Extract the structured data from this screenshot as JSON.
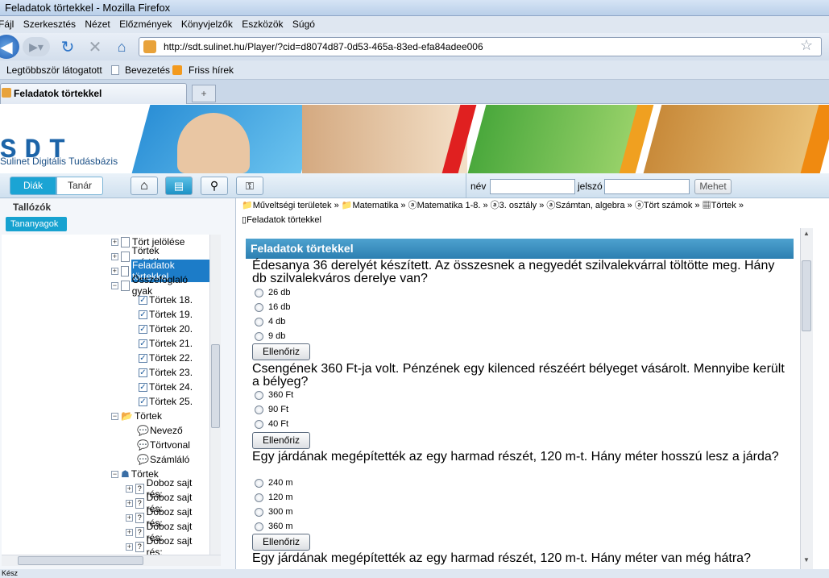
{
  "window": {
    "title": "Feladatok törtekkel - Mozilla Firefox"
  },
  "menu": [
    "Fájl",
    "Szerkesztés",
    "Nézet",
    "Előzmények",
    "Könyvjelzők",
    "Eszközök",
    "Súgó"
  ],
  "address": {
    "url": "http://sdt.sulinet.hu/Player/?cid=d8074d87-0d53-465a-83ed-efa84adee006"
  },
  "bookmarks": [
    "Legtöbbször látogatott",
    "Bevezetés",
    "Friss hírek"
  ],
  "tab": {
    "label": "Feladatok törtekkel"
  },
  "site": {
    "logo": "SDT",
    "logo_sub": "Sulinet Digitális Tudásbázis"
  },
  "modes": {
    "student": "Diák",
    "teacher": "Tanár"
  },
  "login": {
    "name_label": "név",
    "password_label": "jelszó",
    "submit": "Mehet"
  },
  "sidebar": {
    "title": "Tallózók",
    "tab": "Tananyagok",
    "items": [
      "Tört jelölése",
      "Törtek mértékegys",
      "Feladatok törtekkel",
      "Összefoglaló gyak",
      "Törtek 18.",
      "Törtek 19.",
      "Törtek 20.",
      "Törtek 21.",
      "Törtek 22.",
      "Törtek 23.",
      "Törtek 24.",
      "Törtek 25.",
      "Törtek",
      "Nevező",
      "Törtvonal",
      "Számláló",
      "Törtek",
      "Doboz sajt rés:",
      "Doboz sajt rés:",
      "Doboz sajt rés:",
      "Doboz sajt rés:",
      "Doboz sajt rés:"
    ]
  },
  "breadcrumb": [
    "Műveltségi területek",
    "Matematika",
    "Matematika 1-8.",
    "3. osztály",
    "Számtan, algebra",
    "Tört számok",
    "Törtek",
    "Feladatok törtekkel"
  ],
  "content": {
    "header": "Feladatok törtekkel",
    "check_label": "Ellenőriz",
    "questions": [
      {
        "text": "Édesanya 36 derelyét készített. Az összesnek a negyedét szilvalekvárral töltötte meg. Hány db szilvalekváros derelye van?",
        "options": [
          "26 db",
          "16 db",
          "4 db",
          "9 db"
        ]
      },
      {
        "text": "Csengének 360 Ft-ja volt. Pénzének egy kilenced részéért bélyeget vásárolt. Mennyibe került a bélyeg?",
        "options": [
          "360 Ft",
          "90 Ft",
          "40 Ft"
        ]
      },
      {
        "text": "Egy járdának megépítették az egy harmad részét, 120 m-t. Hány méter hosszú lesz a járda?",
        "options": [
          "240 m",
          "120 m",
          "300 m",
          "360 m"
        ]
      },
      {
        "text": "Egy járdának megépítették az egy harmad részét, 120 m-t. Hány méter van még hátra?",
        "options": []
      }
    ]
  },
  "status": {
    "text": "Kész"
  },
  "colors": {
    "accent": "#17a2d0",
    "header_blue": "#2c7fb1"
  }
}
